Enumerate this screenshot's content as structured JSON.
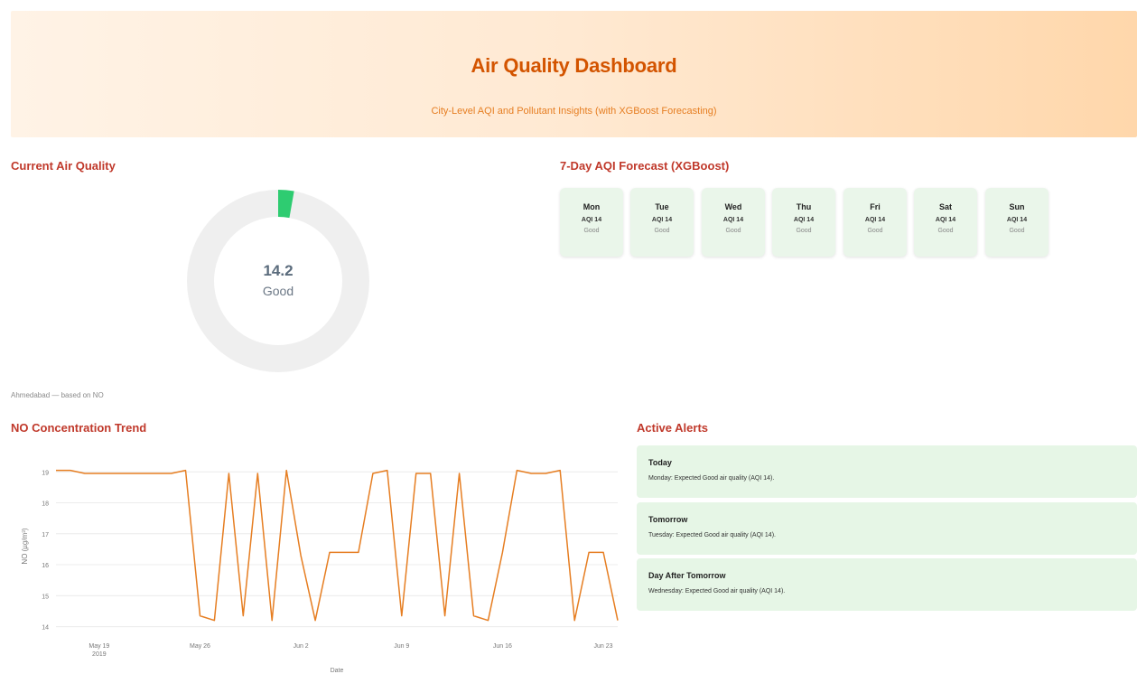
{
  "header": {
    "title": "Air Quality Dashboard",
    "subtitle": "City-Level AQI and Pollutant Insights (with XGBoost Forecasting)"
  },
  "current": {
    "section_title": "Current Air Quality",
    "value": "14.2",
    "category": "Good",
    "gauge_fraction": 0.028,
    "gauge_color": "#2ecc71",
    "caption": "Ahmedabad — based on NO"
  },
  "forecast": {
    "section_title": "7-Day AQI Forecast (XGBoost)",
    "days": [
      {
        "day": "Mon",
        "aqi": "AQI 14",
        "category": "Good"
      },
      {
        "day": "Tue",
        "aqi": "AQI 14",
        "category": "Good"
      },
      {
        "day": "Wed",
        "aqi": "AQI 14",
        "category": "Good"
      },
      {
        "day": "Thu",
        "aqi": "AQI 14",
        "category": "Good"
      },
      {
        "day": "Fri",
        "aqi": "AQI 14",
        "category": "Good"
      },
      {
        "day": "Sat",
        "aqi": "AQI 14",
        "category": "Good"
      },
      {
        "day": "Sun",
        "aqi": "AQI 14",
        "category": "Good"
      }
    ]
  },
  "trend": {
    "section_title": "NO Concentration Trend"
  },
  "alerts": {
    "section_title": "Active Alerts",
    "items": [
      {
        "title": "Today",
        "message": "Monday: Expected Good air quality (AQI 14)."
      },
      {
        "title": "Tomorrow",
        "message": "Tuesday: Expected Good air quality (AQI 14)."
      },
      {
        "title": "Day After Tomorrow",
        "message": "Wednesday: Expected Good air quality (AQI 14)."
      }
    ]
  },
  "chart_data": {
    "type": "line",
    "title": "",
    "xlabel": "Date",
    "ylabel": "NO (µg/m³)",
    "ylim": [
      13.9,
      19.3
    ],
    "xlim": [
      "2019-05-16",
      "2019-06-24"
    ],
    "yticks": [
      14,
      15,
      16,
      17,
      18,
      19
    ],
    "xticks": [
      {
        "date": "2019-05-19",
        "label": "May 19",
        "sublabel": "2019"
      },
      {
        "date": "2019-05-26",
        "label": "May 26",
        "sublabel": ""
      },
      {
        "date": "2019-06-02",
        "label": "Jun 2",
        "sublabel": ""
      },
      {
        "date": "2019-06-09",
        "label": "Jun 9",
        "sublabel": ""
      },
      {
        "date": "2019-06-16",
        "label": "Jun 16",
        "sublabel": ""
      },
      {
        "date": "2019-06-23",
        "label": "Jun 23",
        "sublabel": ""
      }
    ],
    "grid": true,
    "color": "#e67e22",
    "series": [
      {
        "x": [
          "2019-05-16",
          "2019-05-17",
          "2019-05-18",
          "2019-05-19",
          "2019-05-20",
          "2019-05-21",
          "2019-05-22",
          "2019-05-23",
          "2019-05-24",
          "2019-05-25",
          "2019-05-26",
          "2019-05-27",
          "2019-05-28",
          "2019-05-29",
          "2019-05-30",
          "2019-05-31",
          "2019-06-01",
          "2019-06-02",
          "2019-06-03",
          "2019-06-04",
          "2019-06-05",
          "2019-06-06",
          "2019-06-07",
          "2019-06-08",
          "2019-06-09",
          "2019-06-10",
          "2019-06-11",
          "2019-06-12",
          "2019-06-13",
          "2019-06-14",
          "2019-06-15",
          "2019-06-16",
          "2019-06-17",
          "2019-06-18",
          "2019-06-19",
          "2019-06-20",
          "2019-06-21",
          "2019-06-22",
          "2019-06-23",
          "2019-06-24"
        ],
        "values": [
          19.05,
          19.05,
          18.95,
          18.95,
          18.95,
          18.95,
          18.95,
          18.95,
          18.95,
          19.05,
          14.35,
          14.2,
          18.95,
          14.35,
          18.95,
          14.2,
          19.05,
          16.3,
          14.2,
          16.4,
          16.4,
          16.4,
          18.95,
          19.05,
          14.35,
          18.95,
          18.95,
          14.35,
          18.95,
          14.35,
          14.2,
          16.4,
          19.05,
          18.95,
          18.95,
          19.05,
          14.2,
          16.4,
          16.4,
          14.2
        ]
      }
    ]
  }
}
